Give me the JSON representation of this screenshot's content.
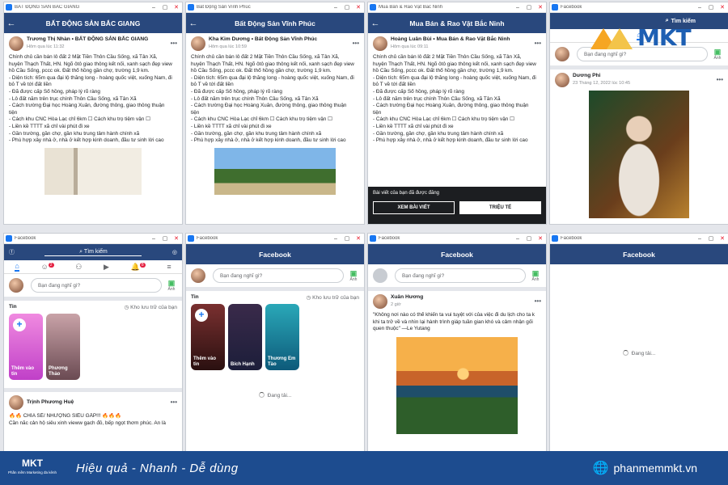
{
  "posts_text": [
    "Chính chủ cần bán lô đất 2 Mặt Tiền Thôn Cầu Sống, xã Tân Xã,",
    "huyện Thạch Thất, HN. Ngõ ôtô giao thông kết nối, xanh sạch đẹp view",
    "hồ Cầu Sống, pccc ok. Đất thổ hồng gần chợ, trường 1,9 km.",
    "- Diện tích: 65m qua đại lộ thăng long - hoàng quốc việt, xuống Nam, đi",
    "bỏ T về tới đất liền",
    "- Đã được cấp Sổ hồng, pháp lý rõ ràng",
    "- Lô đất nằm trên trục chính Thôn Cầu Sống, xã Tân Xã",
    "- Cách trường Đại học Hoàng Xuân, đường thông, giao thông thuận",
    "tiện",
    "- Cách khu CNC Hòa Lạc chỉ 6km ☐ Cách khu trọ tiệm vận ☐",
    "- Liền kề TTTT xã chỉ vài phút đi xe",
    "- Gần trường, gần chợ, gần khu trung tâm hành chính xã",
    "- Phù hợp xây nhà ở, nhà ở kết hợp kinh doanh, đầu tư sinh lời cao"
  ],
  "w1": {
    "titlebar": "BẤT ĐỘNG SẢN BẮC GIANG",
    "header": "BẤT ĐỘNG SẢN BẮC GIANG",
    "author": "Trương Thị Nhàn • BẤT ĐỘNG SẢN BẮC GIANG",
    "time": "Hôm qua lúc 11:32"
  },
  "w2": {
    "titlebar": "Bất Động Sản Vĩnh Phúc",
    "header": "Bất Động Sản Vĩnh Phúc",
    "author": "Kha Kim Dương • Bất Động Sản Vĩnh Phúc",
    "time": "Hôm qua lúc 10:59"
  },
  "w3": {
    "titlebar": "Mua Bán & Rao Vặt Bắc Ninh",
    "header": "Mua Bán & Rao Vặt Bắc Ninh",
    "author": "Hoàng Luân Bùi • Mua Bán & Rao Vặt Bắc Ninh",
    "time": "Hôm qua lúc 09:11",
    "overlay_text": "Bài viết của bạn đã được đăng",
    "btn_view": "XEM BÀI VIẾT",
    "btn_boost": "TRIỆU TẾ"
  },
  "w4": {
    "titlebar": "Facebook",
    "header": "Tìm kiếm",
    "composer": "Bạn đang nghĩ gì?",
    "photo": "Ảnh",
    "author": "Dương Phi",
    "time": "23 Tháng 12, 2022 lúc 10:45"
  },
  "w5": {
    "titlebar": "Facebook",
    "search": "Tìm kiếm",
    "composer": "Bạn đang nghĩ gì?",
    "photo": "Ảnh",
    "stories_label": "Tin",
    "stories_more": "Kho lưu trữ của bạn",
    "story1": "Thêm vào tin",
    "story2": "Phương Thảo",
    "badge1": "2",
    "badge2": "8",
    "author": "Trịnh Phương Huệ",
    "time": "",
    "text1": "🔥🔥 CHÍA SẺ/ NHƯỢNG SIÊU GẤP!!! 🔥🔥🔥",
    "text2": "Cần nắc cản hộ siêu xinh vieww gạch đỏ, bếp ngọt thơm phúc. An là"
  },
  "w6": {
    "titlebar": "Facebook",
    "header": "Facebook",
    "composer": "Bạn đang nghĩ gì?",
    "photo": "Ảnh",
    "stories_label": "Tin",
    "stories_more": "Kho lưu trữ của bạn",
    "story1": "Thêm vào tin",
    "story2": "Bích Hạnh",
    "story3": "Thương Em Tào",
    "loading": "Đang tải..."
  },
  "w7": {
    "titlebar": "Facebook",
    "header": "Facebook",
    "composer": "Bạn đang nghĩ gì?",
    "photo": "Ảnh",
    "author": "Xuân Hương",
    "time": "2 giờ",
    "quote1": "\"Không nơi nào có thể khiến ta vui tuyệt với của việc đi du lịch cho ta k",
    "quote2": "khi ta trở về và nhìn lại hành trình giáp tuần gian khó và cảm nhận gối",
    "quote3": "quen thuộc\" —Le Yutang"
  },
  "w8": {
    "titlebar": "Facebook",
    "header": "Facebook",
    "loading": "Đang tải..."
  },
  "footer": {
    "logo": "MKT",
    "logo_sub": "Phần mềm Marketing đa kênh",
    "slogan": "Hiệu quả - Nhanh - Dễ dùng",
    "site": "phanmemmkt.vn"
  },
  "brand_logo": "MKT",
  "colors": {
    "fb_header": "#29487d",
    "footer": "#1d4c8f",
    "accent": "#1877f2"
  }
}
